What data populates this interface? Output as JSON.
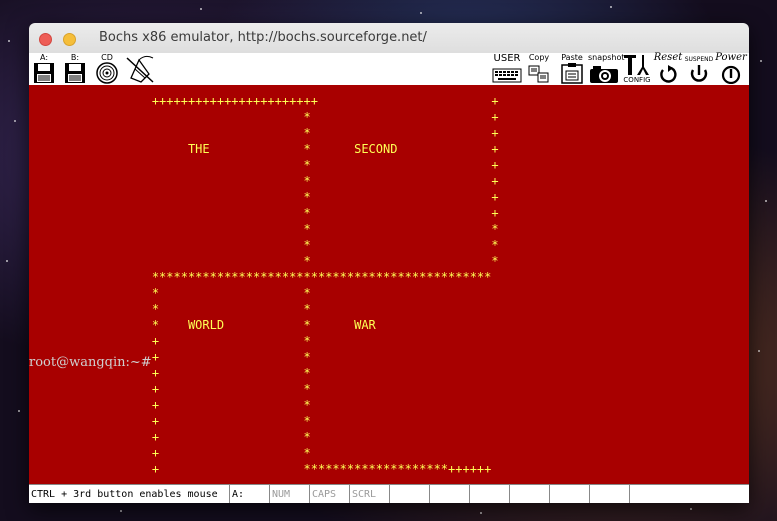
{
  "window": {
    "title": "Bochs x86 emulator, http://bochs.sourceforge.net/"
  },
  "toolbar": {
    "floppy_a_label": "A:",
    "floppy_b_label": "B:",
    "cdrom_label": "CD",
    "user_label": "USER",
    "copy_label": "Copy",
    "paste_label": "Paste",
    "snapshot_label": "snapshot",
    "config_label": "CONFIG",
    "reset_label": "Reset",
    "suspend_label": "SUSPEND",
    "power_label": "Power"
  },
  "screen": {
    "lines": [
      "                 +++++++++++++++++++++++                        +",
      "                                      *                         +",
      "                                      *                         +",
      "                      THE             *      SECOND             +",
      "                                      *                         +",
      "                                      *                         +",
      "                                      *                         +",
      "                                      *                         +",
      "                                      *                         *",
      "                                      *                         *",
      "                                      *                         *",
      "                 ***********************************************",
      "                 *                    *",
      "                 *                    *",
      "                 *    WORLD           *      WAR",
      "                 +                    *",
      "                 +                    *",
      "                 +                    *",
      "                 +                    *",
      "                 +                    *",
      "                 +                    *",
      "                 +                    *",
      "                 +                    *",
      "                 +                    ********************++++++"
    ],
    "prompt": "root@wangqin:~#"
  },
  "statusbar": {
    "message": "CTRL + 3rd button enables mouse",
    "drive": "A:",
    "num": "NUM",
    "caps": "CAPS",
    "scrl": "SCRL"
  },
  "colors": {
    "screen_bg": "#a80000",
    "screen_fg": "#ffff55"
  }
}
